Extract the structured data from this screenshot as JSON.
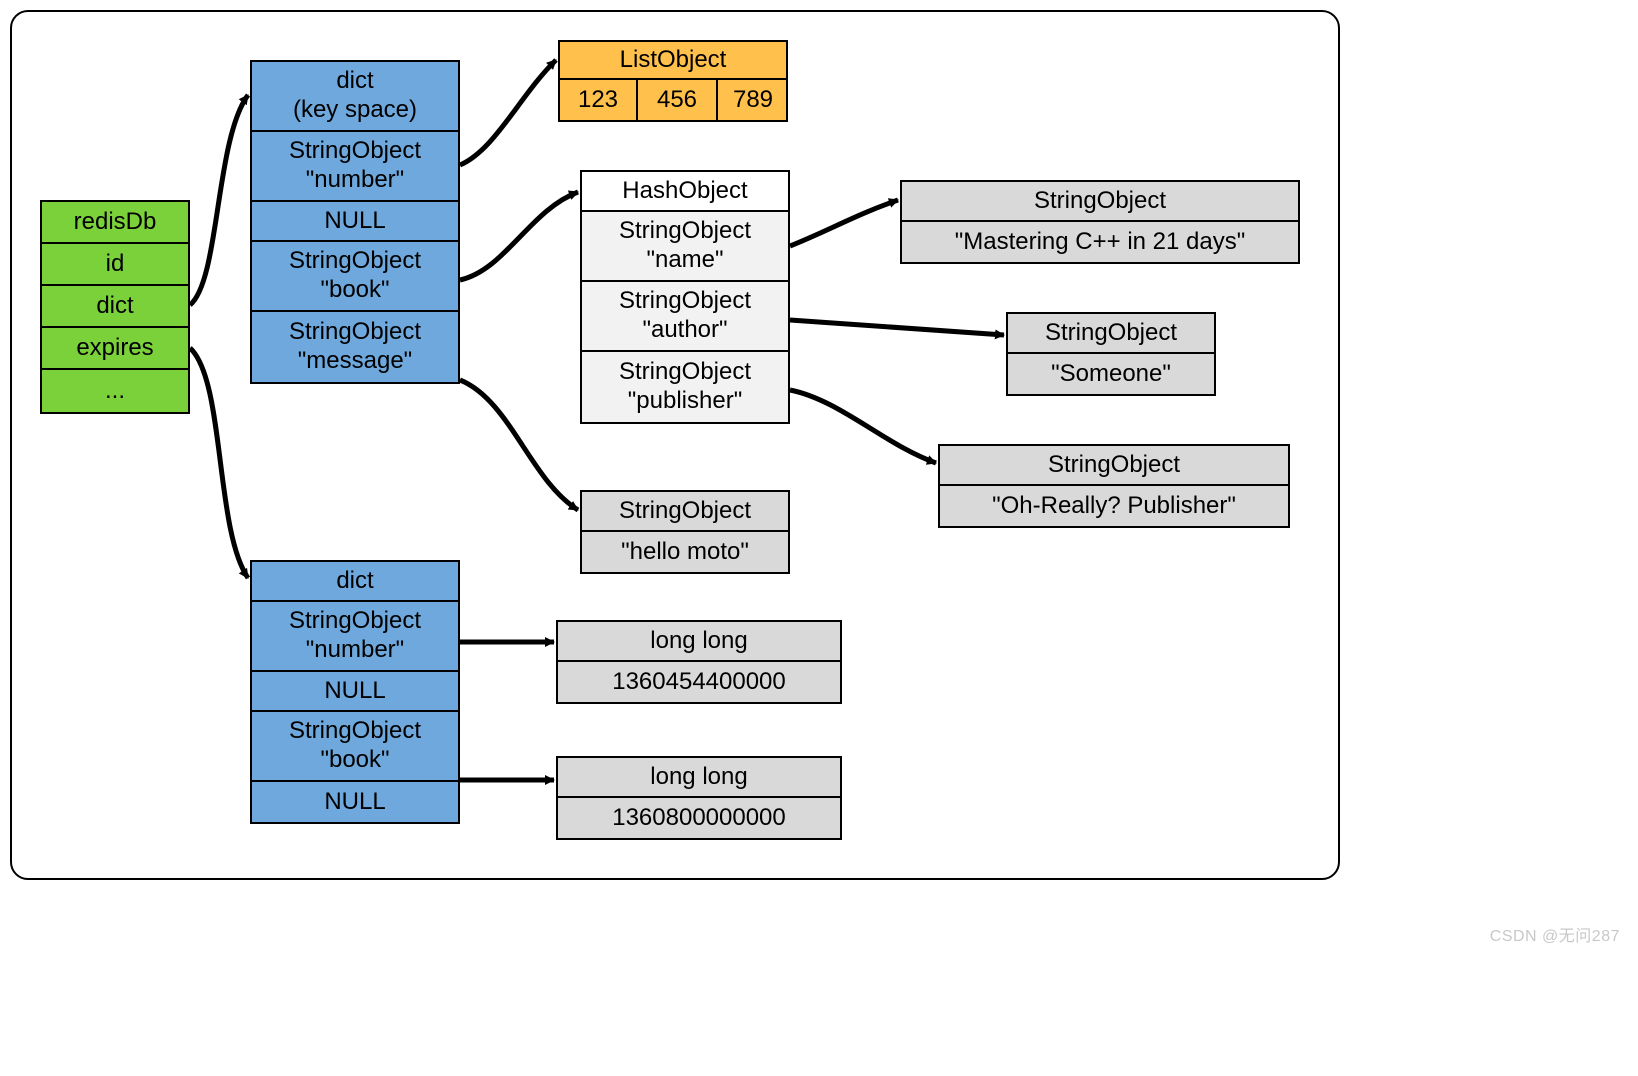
{
  "redisDb": {
    "title": "redisDb",
    "fields": [
      "id",
      "dict",
      "expires",
      "..."
    ]
  },
  "dictKeyspace": {
    "title1": "dict",
    "title2": "(key space)",
    "rows": [
      {
        "l1": "StringObject",
        "l2": "\"number\""
      },
      {
        "l1": "NULL",
        "l2": ""
      },
      {
        "l1": "StringObject",
        "l2": "\"book\""
      },
      {
        "l1": "StringObject",
        "l2": "\"message\""
      }
    ]
  },
  "listObject": {
    "title": "ListObject",
    "items": [
      "123",
      "456",
      "789"
    ]
  },
  "hashObject": {
    "title": "HashObject",
    "rows": [
      {
        "l1": "StringObject",
        "l2": "\"name\""
      },
      {
        "l1": "StringObject",
        "l2": "\"author\""
      },
      {
        "l1": "StringObject",
        "l2": "\"publisher\""
      }
    ]
  },
  "helloMoto": {
    "title": "StringObject",
    "value": "\"hello moto\""
  },
  "mastering": {
    "title": "StringObject",
    "value": "\"Mastering C++ in 21 days\""
  },
  "someone": {
    "title": "StringObject",
    "value": "\"Someone\""
  },
  "publisher": {
    "title": "StringObject",
    "value": "\"Oh-Really? Publisher\""
  },
  "dictExpires": {
    "title": "dict",
    "rows": [
      {
        "l1": "StringObject",
        "l2": "\"number\""
      },
      {
        "l1": "NULL",
        "l2": ""
      },
      {
        "l1": "StringObject",
        "l2": "\"book\""
      },
      {
        "l1": "NULL",
        "l2": ""
      }
    ]
  },
  "long1": {
    "title": "long long",
    "value": "1360454400000"
  },
  "long2": {
    "title": "long long",
    "value": "1360800000000"
  },
  "watermark": "CSDN @无问287"
}
